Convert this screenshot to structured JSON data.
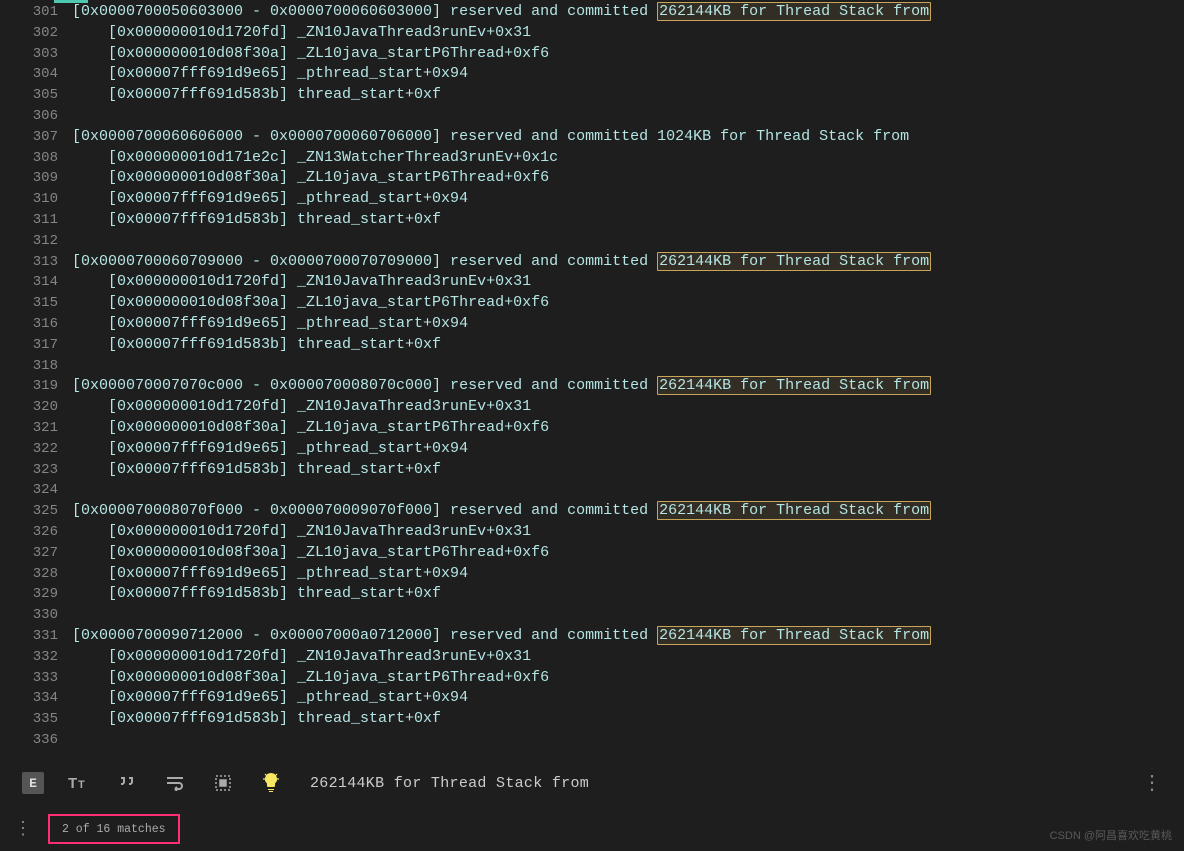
{
  "search": {
    "query": "262144KB for Thread Stack from"
  },
  "status": {
    "matches": "2 of 16 matches"
  },
  "watermark": "CSDN @阿昌喜欢吃黄桃",
  "highlight": "262144KB for Thread Stack from",
  "lines": [
    {
      "n": 301,
      "pre": "[0x0000700050603000 - 0x0000700060603000] reserved and committed ",
      "hl": true
    },
    {
      "n": 302,
      "text": "    [0x000000010d1720fd] _ZN10JavaThread3runEv+0x31"
    },
    {
      "n": 303,
      "text": "    [0x000000010d08f30a] _ZL10java_startP6Thread+0xf6"
    },
    {
      "n": 304,
      "text": "    [0x00007fff691d9e65] _pthread_start+0x94"
    },
    {
      "n": 305,
      "text": "    [0x00007fff691d583b] thread_start+0xf"
    },
    {
      "n": 306,
      "text": ""
    },
    {
      "n": 307,
      "text": "[0x0000700060606000 - 0x0000700060706000] reserved and committed 1024KB for Thread Stack from"
    },
    {
      "n": 308,
      "text": "    [0x000000010d171e2c] _ZN13WatcherThread3runEv+0x1c"
    },
    {
      "n": 309,
      "text": "    [0x000000010d08f30a] _ZL10java_startP6Thread+0xf6"
    },
    {
      "n": 310,
      "text": "    [0x00007fff691d9e65] _pthread_start+0x94"
    },
    {
      "n": 311,
      "text": "    [0x00007fff691d583b] thread_start+0xf"
    },
    {
      "n": 312,
      "text": ""
    },
    {
      "n": 313,
      "pre": "[0x0000700060709000 - 0x0000700070709000] reserved and committed ",
      "hl": true
    },
    {
      "n": 314,
      "text": "    [0x000000010d1720fd] _ZN10JavaThread3runEv+0x31"
    },
    {
      "n": 315,
      "text": "    [0x000000010d08f30a] _ZL10java_startP6Thread+0xf6"
    },
    {
      "n": 316,
      "text": "    [0x00007fff691d9e65] _pthread_start+0x94"
    },
    {
      "n": 317,
      "text": "    [0x00007fff691d583b] thread_start+0xf"
    },
    {
      "n": 318,
      "text": ""
    },
    {
      "n": 319,
      "pre": "[0x000070007070c000 - 0x000070008070c000] reserved and committed ",
      "hl": true
    },
    {
      "n": 320,
      "text": "    [0x000000010d1720fd] _ZN10JavaThread3runEv+0x31"
    },
    {
      "n": 321,
      "text": "    [0x000000010d08f30a] _ZL10java_startP6Thread+0xf6"
    },
    {
      "n": 322,
      "text": "    [0x00007fff691d9e65] _pthread_start+0x94"
    },
    {
      "n": 323,
      "text": "    [0x00007fff691d583b] thread_start+0xf"
    },
    {
      "n": 324,
      "text": ""
    },
    {
      "n": 325,
      "pre": "[0x000070008070f000 - 0x000070009070f000] reserved and committed ",
      "hl": true
    },
    {
      "n": 326,
      "text": "    [0x000000010d1720fd] _ZN10JavaThread3runEv+0x31"
    },
    {
      "n": 327,
      "text": "    [0x000000010d08f30a] _ZL10java_startP6Thread+0xf6"
    },
    {
      "n": 328,
      "text": "    [0x00007fff691d9e65] _pthread_start+0x94"
    },
    {
      "n": 329,
      "text": "    [0x00007fff691d583b] thread_start+0xf"
    },
    {
      "n": 330,
      "text": ""
    },
    {
      "n": 331,
      "pre": "[0x0000700090712000 - 0x00007000a0712000] reserved and committed ",
      "hl": true
    },
    {
      "n": 332,
      "text": "    [0x000000010d1720fd] _ZN10JavaThread3runEv+0x31"
    },
    {
      "n": 333,
      "text": "    [0x000000010d08f30a] _ZL10java_startP6Thread+0xf6"
    },
    {
      "n": 334,
      "text": "    [0x00007fff691d9e65] _pthread_start+0x94"
    },
    {
      "n": 335,
      "text": "    [0x00007fff691d583b] thread_start+0xf"
    },
    {
      "n": 336,
      "text": ""
    }
  ]
}
